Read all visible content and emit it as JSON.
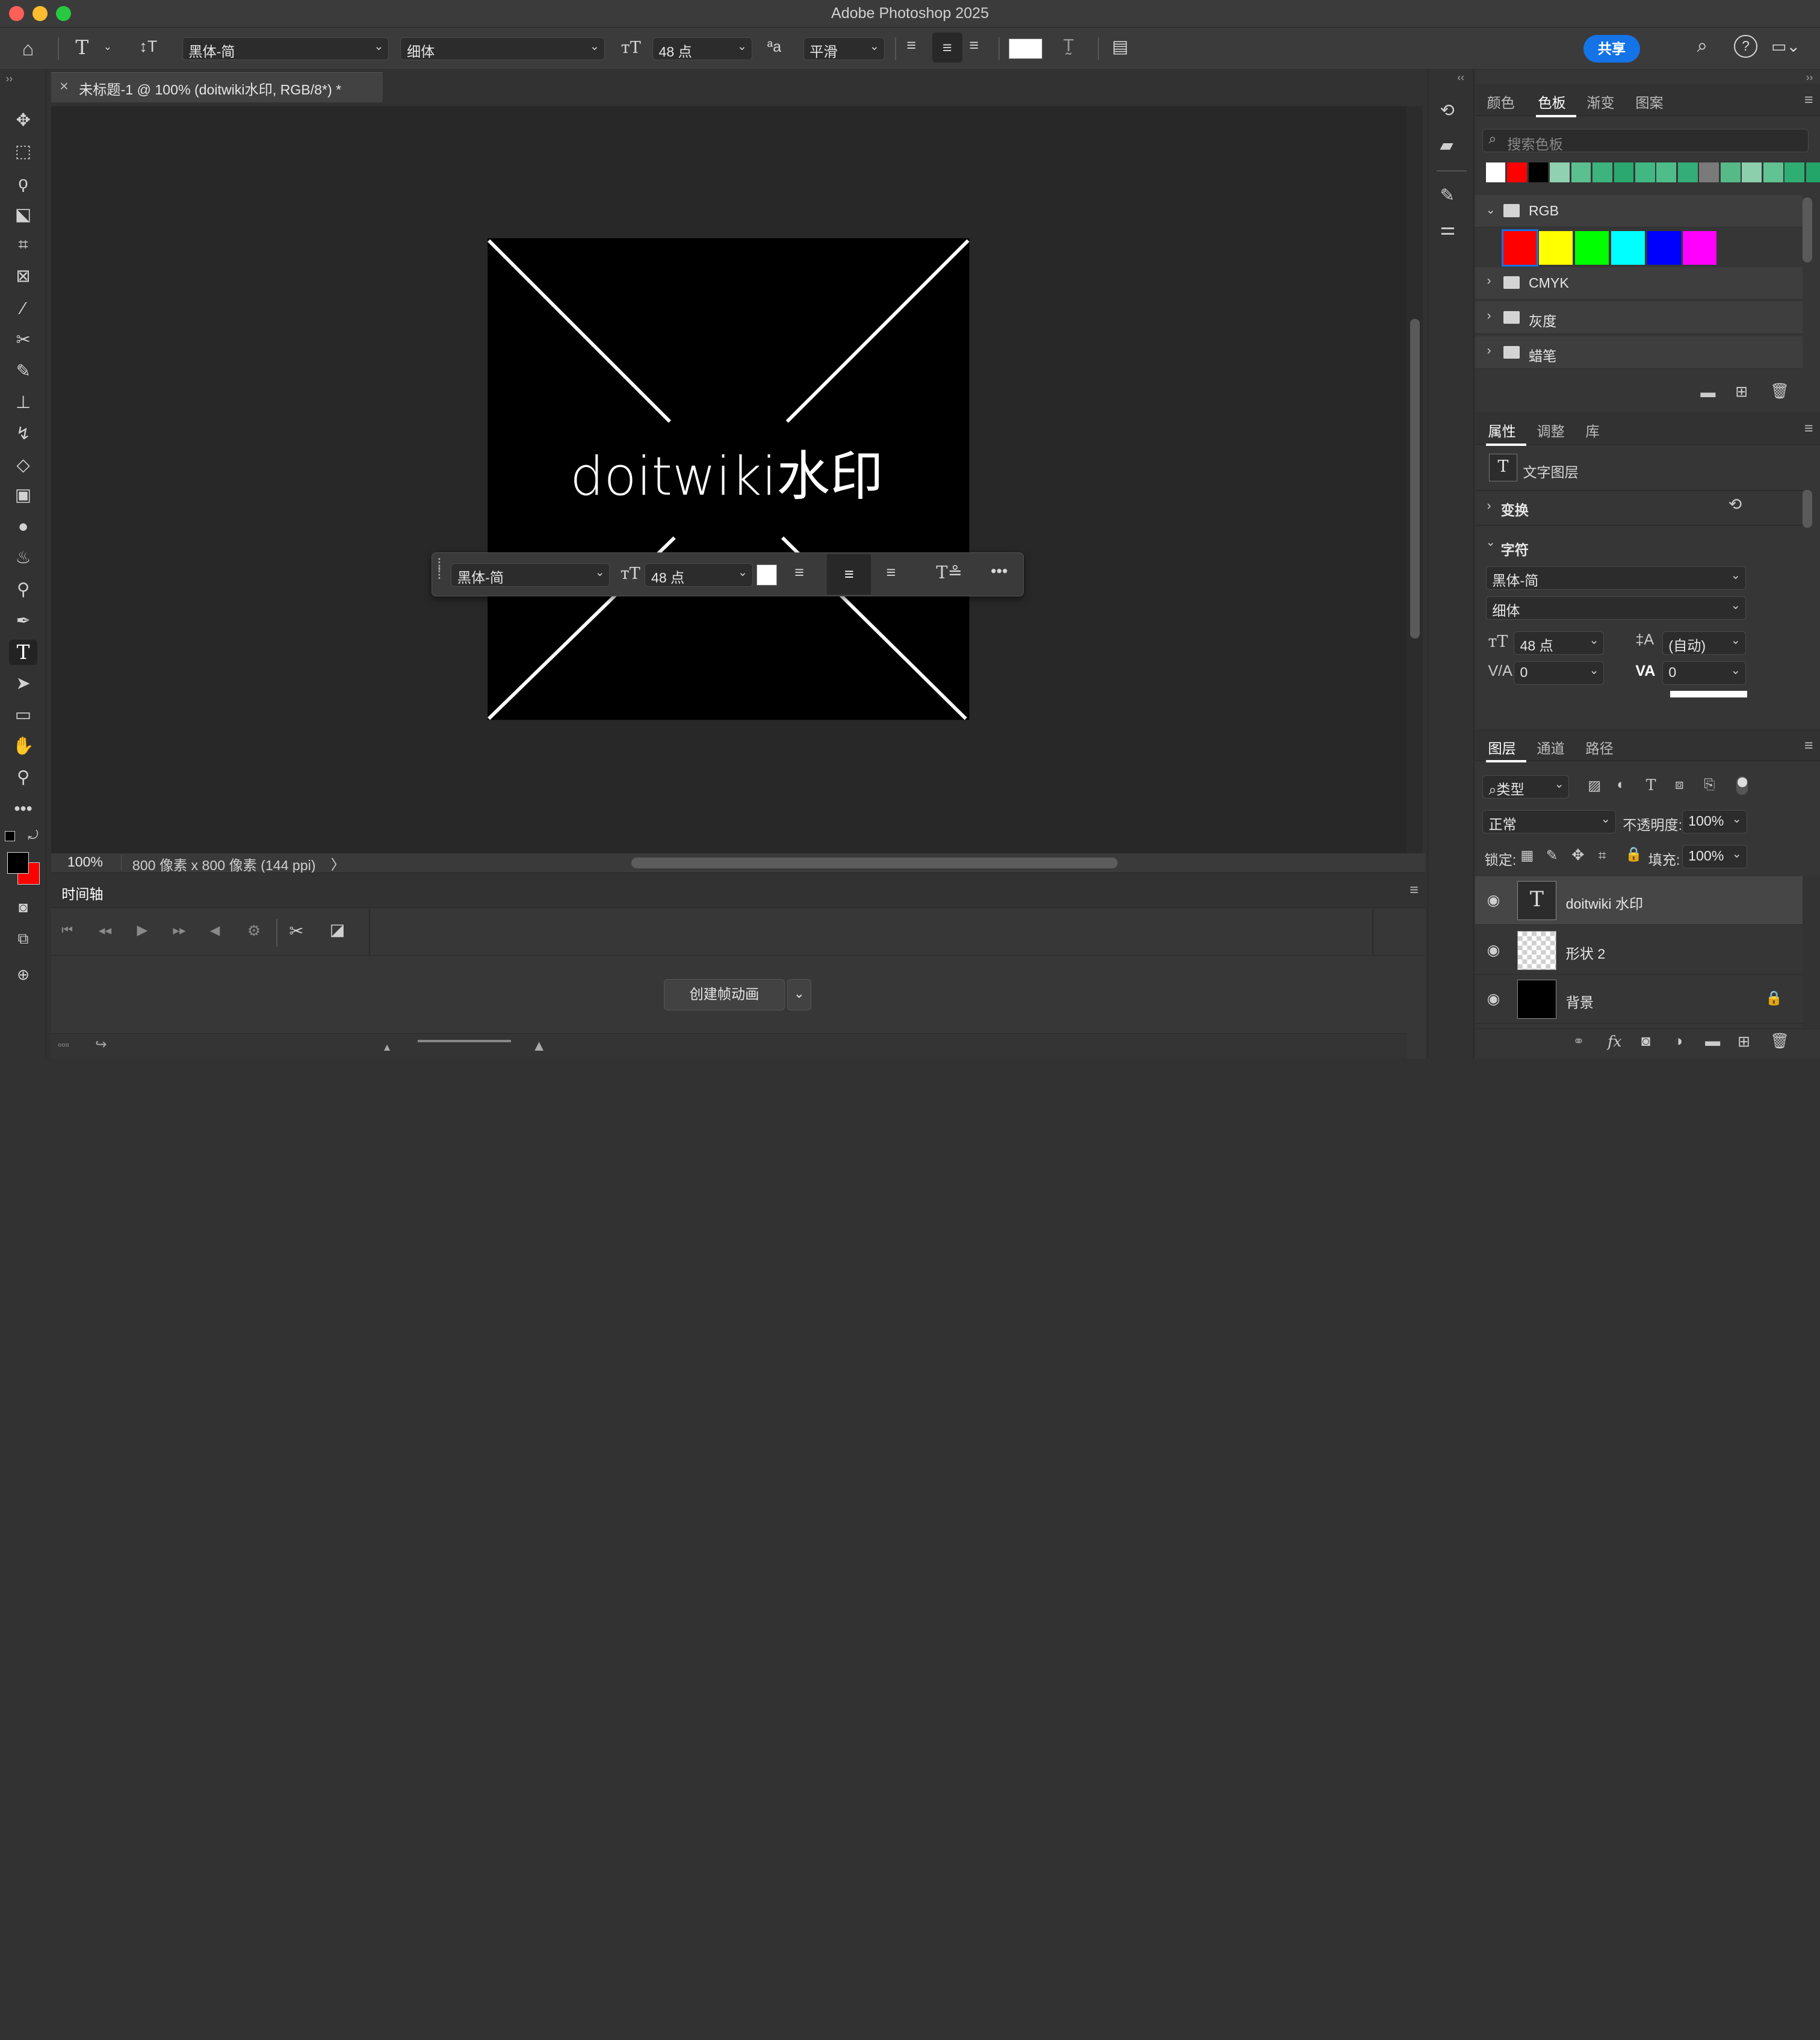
{
  "window": {
    "title": "Adobe Photoshop 2025"
  },
  "options_bar": {
    "font_family": "黑体-简",
    "font_style": "细体",
    "font_size": "48 点",
    "aa_label": "ªa",
    "antialias": "平滑",
    "share_label": "共享"
  },
  "document": {
    "tab_title": "未标题-1 @ 100% (doitwiki水印, RGB/8*) *",
    "canvas_text": "doitwiki水印",
    "zoom": "100%",
    "doc_info": "800 像素 x 800 像素 (144 ppi)"
  },
  "context_bar": {
    "font_family": "黑体-简",
    "font_size": "48 点"
  },
  "timeline": {
    "title": "时间轴",
    "create_button": "创建帧动画"
  },
  "swatches_panel": {
    "tabs": [
      "颜色",
      "色板",
      "渐变",
      "图案"
    ],
    "active_tab": 1,
    "search_placeholder": "搜索色板",
    "recent_colors": [
      "#ffffff",
      "#ff0000",
      "#000000",
      "#8fd1b0",
      "#5bc08f",
      "#3db37d",
      "#2aa86f",
      "#41b883",
      "#4fbd8a",
      "#35ad78",
      "#7a7a7a",
      "#56ba88",
      "#8ccfad",
      "#61c393",
      "#2fae74",
      "#23a56a"
    ],
    "groups": [
      {
        "name": "RGB",
        "expanded": true,
        "colors": [
          "#ff0000",
          "#ffff00",
          "#00ff00",
          "#00ffff",
          "#0000ff",
          "#ff00ff"
        ]
      },
      {
        "name": "CMYK",
        "expanded": false
      },
      {
        "name": "灰度",
        "expanded": false
      },
      {
        "name": "蜡笔",
        "expanded": false
      }
    ]
  },
  "properties_panel": {
    "tabs": [
      "属性",
      "调整",
      "库"
    ],
    "active_tab": 0,
    "layer_type": "文字图层",
    "transform_label": "变换",
    "character_label": "字符",
    "font_family": "黑体-简",
    "font_style": "细体",
    "font_size": "48 点",
    "leading": "(自动)",
    "kerning": "0",
    "tracking": "0"
  },
  "layers_panel": {
    "tabs": [
      "图层",
      "通道",
      "路径"
    ],
    "active_tab": 0,
    "filter_label": "类型",
    "blend_mode": "正常",
    "opacity_label": "不透明度:",
    "opacity": "100%",
    "lock_label": "锁定:",
    "fill_label": "填充:",
    "fill": "100%",
    "layers": [
      {
        "name": "doitwiki 水印",
        "type": "text",
        "selected": true
      },
      {
        "name": "形状 2",
        "type": "shape",
        "selected": false
      },
      {
        "name": "背景",
        "type": "background",
        "selected": false,
        "locked": true
      }
    ]
  },
  "colors": {
    "accent": "#1473e6",
    "foreground": "#000000",
    "background": "#ff0000"
  }
}
